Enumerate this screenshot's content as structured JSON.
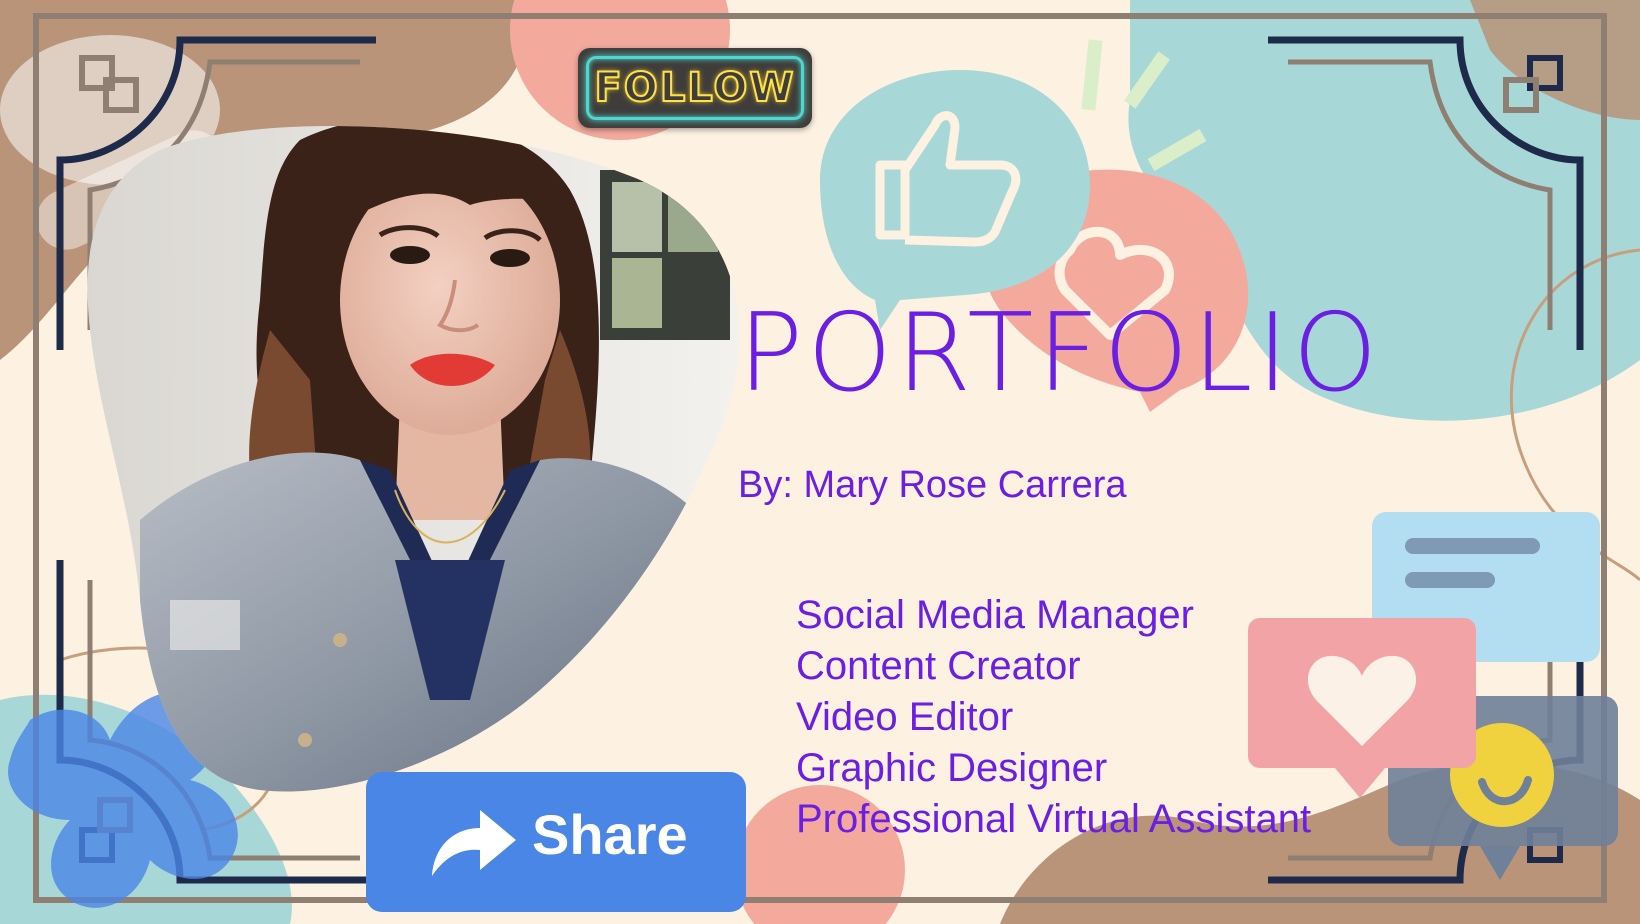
{
  "slide": {
    "title": "PORTFOLIO",
    "byline": "By: Mary Rose Carrera",
    "roles": [
      "Social Media Manager",
      "Content Creator",
      "Video Editor",
      "Graphic Designer",
      "Professional Virtual Assistant"
    ]
  },
  "buttons": {
    "follow_label": "FOLLOW",
    "share_label": "Share"
  },
  "photo": {
    "subject": "portrait-photo"
  },
  "icons": {
    "like": "thumbs-up-icon",
    "heart_bubble": "heart-bubble-icon",
    "heart_notification": "heart-notification-icon",
    "smiley": "smiley-icon",
    "message": "message-icon",
    "share": "share-arrow-icon"
  },
  "colors": {
    "text_accent": "#6a1fe2",
    "background": "#fdf1e2",
    "share_button": "#4a86e6",
    "follow_neon_text": "#ffe14a",
    "follow_neon_border": "#4fd6cf"
  }
}
